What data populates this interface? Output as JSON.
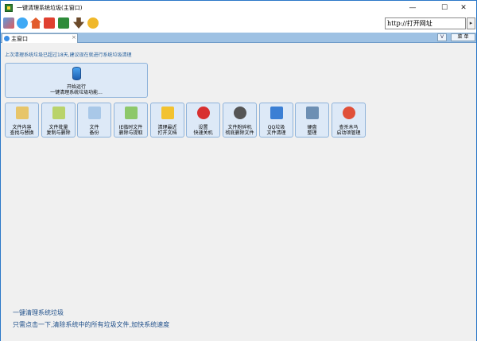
{
  "window": {
    "title": "一键清理系统垃圾(主窗口)",
    "minimize_glyph": "—",
    "maximize_glyph": "☐",
    "close_glyph": "✕"
  },
  "toolbar": {
    "url_placeholder": "http://打开网址",
    "go_glyph": "▸",
    "icons": [
      "grid-icon",
      "recycle-icon",
      "home-icon",
      "shop-icon",
      "green-app-icon",
      "user-icon",
      "link-icon"
    ]
  },
  "tabs": {
    "active_label": "主窗口",
    "close_glyph": "×",
    "dropdown_label": "V",
    "menu_label": "菜 单"
  },
  "main": {
    "notice": "上次清理系统垃圾已超过18天,建议现在就进行系统垃圾清理",
    "primary_action": {
      "line1": "开始运行",
      "line2": "一键清理系统垃圾功能..."
    },
    "tools": [
      {
        "line1": "文件内容",
        "line2": "查找与替换",
        "icon_color": "#e7c56a"
      },
      {
        "line1": "文件批量",
        "line2": "复制与删除",
        "icon_color": "#b9d36b"
      },
      {
        "line1": "文件",
        "line2": "备份",
        "icon_color": "#a9c8e8"
      },
      {
        "line1": "IE临时文件",
        "line2": "删除与提取",
        "icon_color": "#8dc86a"
      },
      {
        "line1": "清理最近",
        "line2": "打开文档",
        "icon_color": "#f2c230"
      },
      {
        "line1": "设置",
        "line2": "快速关机",
        "icon_color": "#d83030"
      },
      {
        "line1": "文件粉碎机",
        "line2": "彻底删除文件",
        "icon_color": "#555555"
      },
      {
        "line1": "QQ垃圾",
        "line2": "文件清理",
        "icon_color": "#3b7fd4"
      },
      {
        "line1": "硬盘",
        "line2": "整理",
        "icon_color": "#6d8fb3"
      },
      {
        "line1": "查杀木马",
        "line2": "启动项管理",
        "icon_color": "#e0503a"
      }
    ],
    "description": {
      "title": "一键清理系统垃圾",
      "body": "只需点击一下,清除系统中的所有垃圾文件,加快系统速度"
    }
  },
  "colors": {
    "accent": "#9ec1e3",
    "button_bg": "#dde9f7",
    "description_text": "#1f4f8a",
    "notice_text": "#1f5b9a"
  }
}
